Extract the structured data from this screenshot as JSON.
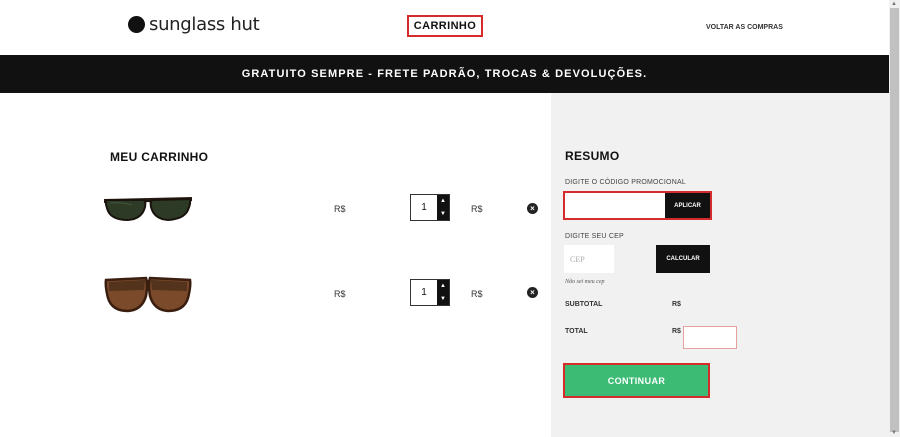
{
  "header": {
    "logo_text": "sunglass hut",
    "title": "CARRINHO",
    "back_link": "VOLTAR AS COMPRAS"
  },
  "banner": {
    "text": "GRATUITO SEMPRE - FRETE PADRÃO, TROCAS & DEVOLUÇÕES."
  },
  "cart": {
    "title": "MEU CARRINHO",
    "items": [
      {
        "product": "green-lens-black-wayfarer-sunglasses",
        "price_label": "R$",
        "quantity": "1",
        "total_label": "R$"
      },
      {
        "product": "brown-gradient-tortoise-oversized-sunglasses",
        "price_label": "R$",
        "quantity": "1",
        "total_label": "R$"
      }
    ]
  },
  "summary": {
    "title": "RESUMO",
    "promo_label": "DIGITE O CÓDIGO PROMOCIONAL",
    "promo_value": "",
    "apply_label": "APLICAR",
    "cep_label": "DIGITE SEU CEP",
    "cep_placeholder": "CEP",
    "calc_label": "CALCULAR",
    "cep_help": "Não sei meu cep",
    "subtotal_label": "SUBTOTAL",
    "subtotal_value": "R$",
    "total_label": "TOTAL",
    "total_value": "R$",
    "continue_label": "CONTINUAR"
  },
  "colors": {
    "accent_green": "#3cbb75",
    "highlight_red": "#d62b2b",
    "banner_black": "#111111",
    "summary_bg": "#f1f1f1"
  }
}
